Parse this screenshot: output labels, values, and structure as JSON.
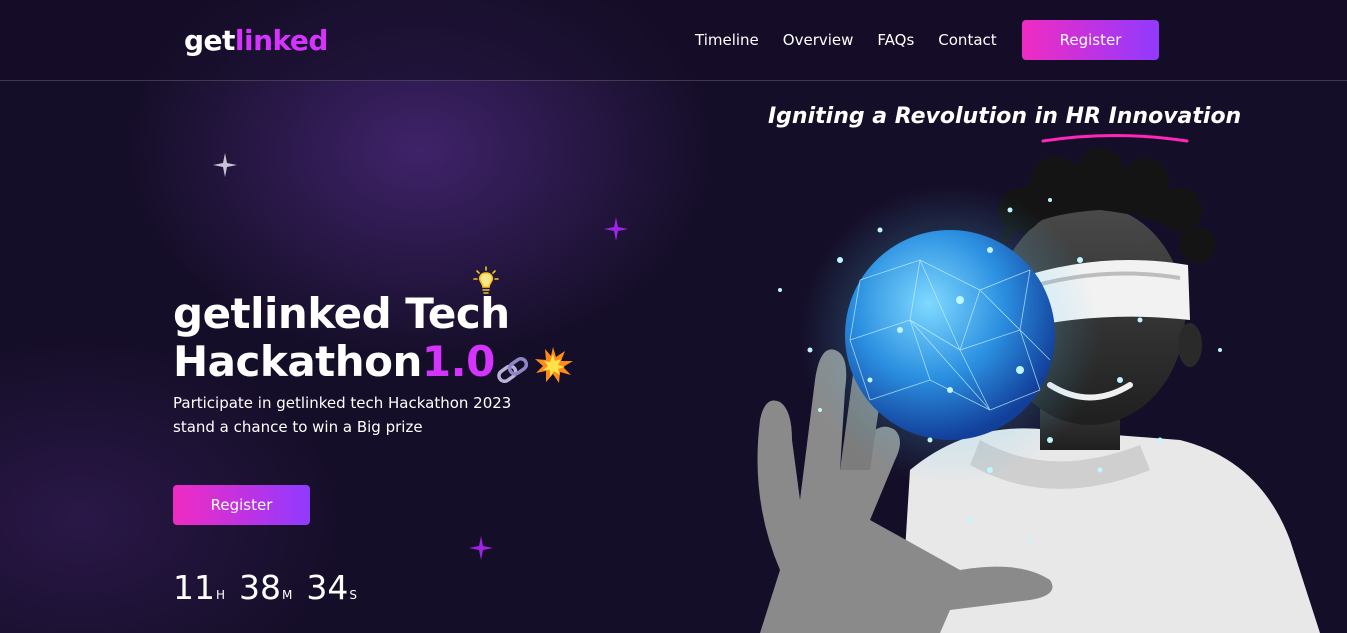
{
  "header": {
    "logo_part1": "get",
    "logo_part2": "linked",
    "nav": [
      "Timeline",
      "Overview",
      "FAQs",
      "Contact"
    ],
    "register_label": "Register"
  },
  "tagline": {
    "text_before": "Igniting a Revolution in ",
    "text_highlight": "HR Innovation"
  },
  "hero": {
    "title_line1": "getlinked Tech",
    "title_line2": "Hackathon",
    "title_version": "1.0",
    "description": "Participate in getlinked tech Hackathon 2023 stand a chance to win a Big prize",
    "register_label": "Register",
    "countdown": {
      "hours": "11",
      "hours_unit": "H",
      "minutes": "38",
      "minutes_unit": "M",
      "seconds": "34",
      "seconds_unit": "S"
    }
  },
  "colors": {
    "accent": "#d434fe",
    "gradient_start": "#f12bc2",
    "gradient_end": "#903aff",
    "background": "#150e28"
  }
}
